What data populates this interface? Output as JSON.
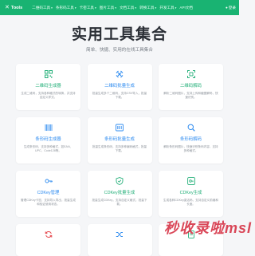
{
  "nav": {
    "brand": "Tools",
    "items": [
      "二维码工具",
      "条形码工具",
      "卡密工具",
      "图片工具",
      "文档工具",
      "转换工具",
      "开发工具",
      "API文档"
    ],
    "login": "登录"
  },
  "hero": {
    "title": "实用工具集合",
    "subtitle": "简单、快捷、实用的在线工具集合"
  },
  "cards": [
    {
      "title": "二维码生成器",
      "desc": "生成二维码，支持各种格式的转换，并支持自定义样式。",
      "icon": "qr-grid-icon",
      "color": "green"
    },
    {
      "title": "二维码批量生成",
      "desc": "批量生成多个二维码，支持CSV导入，批量下载。",
      "icon": "qr-scan-icon",
      "color": "blue"
    },
    {
      "title": "二维码解码",
      "desc": "解析二维码图片，支持上传和截图解码，快速识别。",
      "icon": "qr-decode-icon",
      "color": "green"
    },
    {
      "title": "条形码生成器",
      "desc": "生成条形码，支持多种格式，如EAN、UPC、Code128等。",
      "icon": "barcode-icon",
      "color": "blue"
    },
    {
      "title": "条形码批量生成",
      "desc": "批量生成条形码，支持多种编码格式，批量下载。",
      "icon": "barcode-batch-icon",
      "color": "blue"
    },
    {
      "title": "条形码解码",
      "desc": "解析条形码图片，快速识别条码内容，支持多种格式。",
      "icon": "barcode-search-icon",
      "color": "blue"
    },
    {
      "title": "CDKey管理",
      "desc": "管理CDKey卡密，支持导入导出，批量生成和验证使用状态。",
      "icon": "key-icon",
      "color": "blue"
    },
    {
      "title": "CDKey批量生成",
      "desc": "批量生成CDKey，支持自定义格式，批量下载。",
      "icon": "shield-icon",
      "color": "green"
    },
    {
      "title": "CDKey生成",
      "desc": "生成各种CDKey激活码，支持自定义前缀和长度。",
      "icon": "key-box-icon",
      "color": "green"
    },
    {
      "title": "",
      "desc": "",
      "icon": "refresh-icon",
      "color": "red"
    },
    {
      "title": "",
      "desc": "",
      "icon": "shuffle-icon",
      "color": "blue"
    },
    {
      "title": "",
      "desc": "",
      "icon": "file-icon",
      "color": "green"
    }
  ],
  "watermark": "秒收录啦msl"
}
